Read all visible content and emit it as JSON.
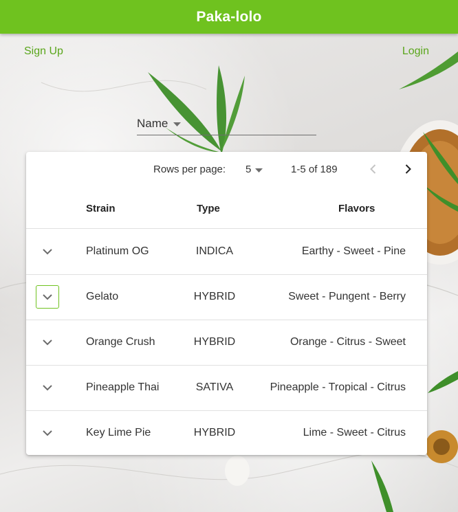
{
  "app": {
    "title": "Paka-lolo"
  },
  "nav": {
    "signup_label": "Sign Up",
    "login_label": "Login"
  },
  "filter": {
    "label": "Name"
  },
  "pagination": {
    "rows_per_page_label": "Rows per page:",
    "rows_per_page_value": "5",
    "range_text": "1-5 of 189"
  },
  "table": {
    "headers": {
      "strain": "Strain",
      "type": "Type",
      "flavors": "Flavors"
    },
    "rows": [
      {
        "strain": "Platinum OG",
        "type": "INDICA",
        "flavors": "Earthy - Sweet - Pine"
      },
      {
        "strain": "Gelato",
        "type": "HYBRID",
        "flavors": "Sweet - Pungent - Berry"
      },
      {
        "strain": "Orange Crush",
        "type": "HYBRID",
        "flavors": "Orange - Citrus - Sweet"
      },
      {
        "strain": "Pineapple Thai",
        "type": "SATIVA",
        "flavors": "Pineapple - Tropical - Citrus"
      },
      {
        "strain": "Key Lime Pie",
        "type": "HYBRID",
        "flavors": "Lime - Sweet - Citrus"
      }
    ]
  },
  "colors": {
    "brand": "#6fc21f",
    "link": "#5aa61c"
  },
  "icons": {
    "expand": "chevron-down-icon",
    "prev": "chevron-left-icon",
    "next": "chevron-right-icon",
    "dropdown": "caret-down-icon"
  }
}
